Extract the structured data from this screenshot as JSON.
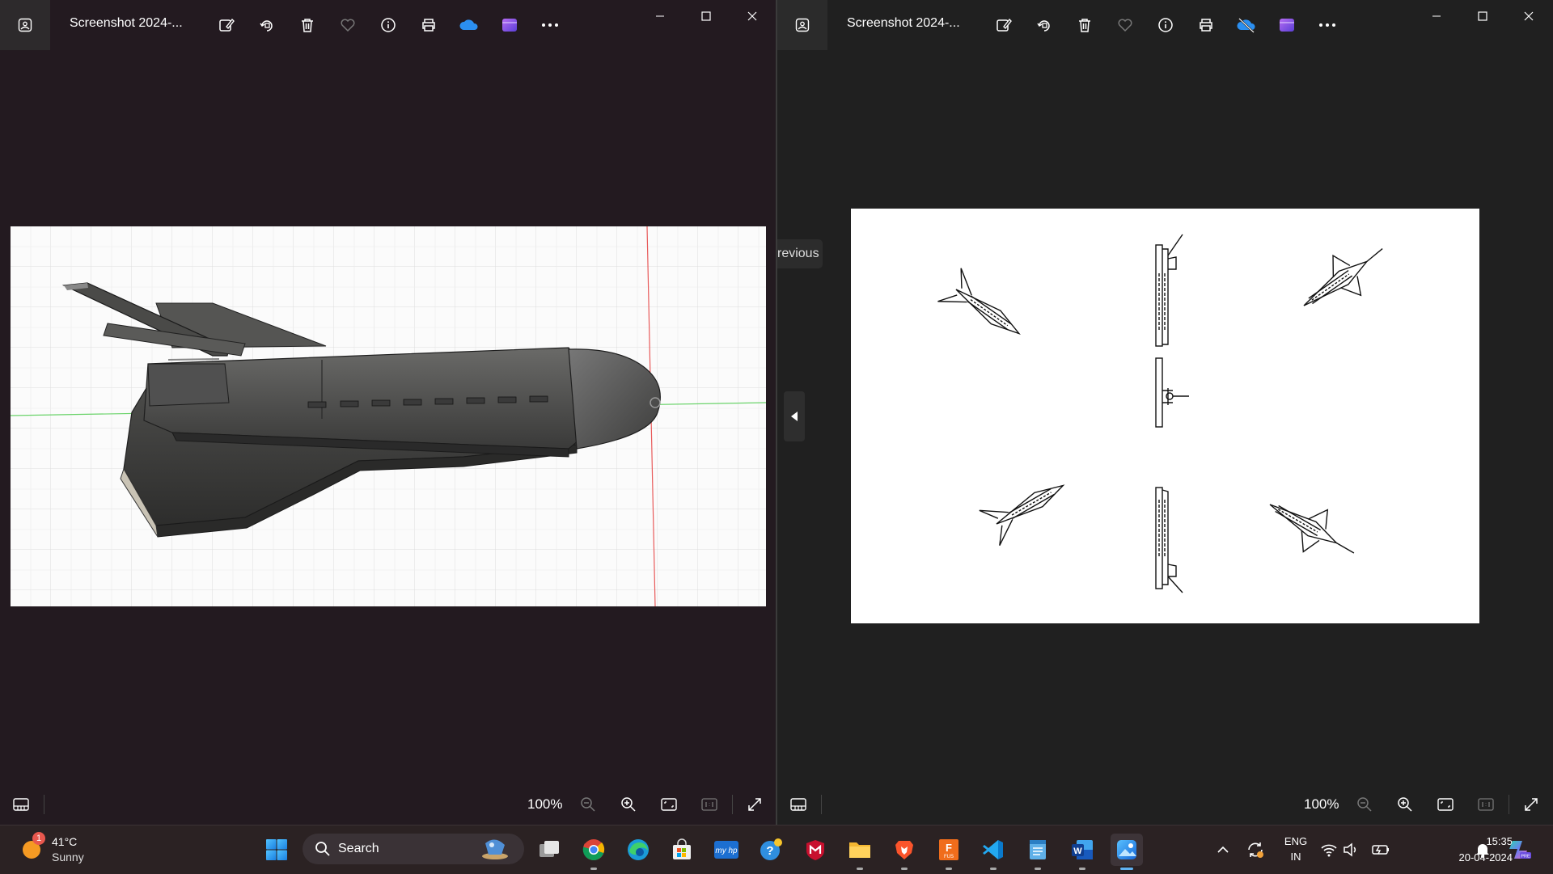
{
  "windows": {
    "left": {
      "title": "Screenshot 2024-...",
      "zoom": "100%"
    },
    "right": {
      "title": "Screenshot 2024-...",
      "zoom": "100%",
      "previous_tooltip": "revious"
    }
  },
  "toolbar_icons": [
    "edit-image-icon",
    "rotate-icon",
    "delete-icon",
    "favorite-icon",
    "info-icon",
    "print-icon",
    "onedrive-icon",
    "clipchamp-icon",
    "more-icon"
  ],
  "taskbar": {
    "weather": {
      "temp": "41°C",
      "desc": "Sunny",
      "badge": "1"
    },
    "search_label": "Search",
    "apps": [
      "start",
      "search",
      "task-view",
      "chrome",
      "edge",
      "store",
      "myhp",
      "help",
      "mcafee",
      "file-explorer",
      "brave",
      "fusion",
      "vscode",
      "notepad",
      "word",
      "photos"
    ],
    "lang_line1": "ENG",
    "lang_line2": "IN",
    "time": "15:35",
    "date": "20-04-2024"
  },
  "colors": {
    "accent": "#5fb2f2",
    "window_left_bg": "#231a20",
    "window_right_bg": "#202020",
    "taskbar_bg": "#2b2223"
  }
}
